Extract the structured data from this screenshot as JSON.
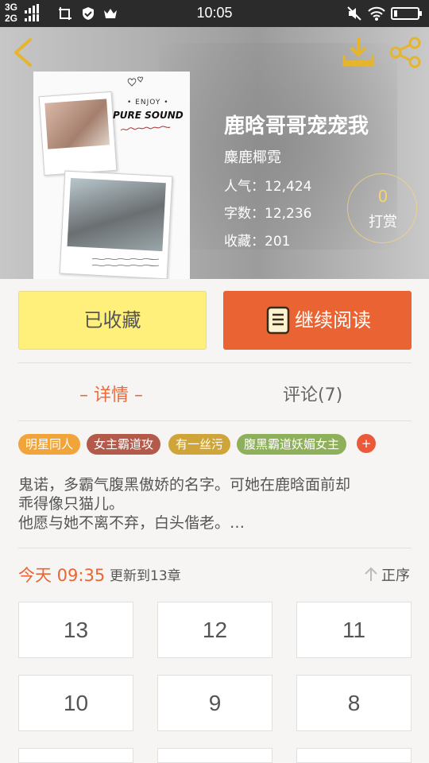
{
  "status_bar": {
    "network": "3G",
    "network2": "2G",
    "time": "10:05"
  },
  "book": {
    "title": "鹿晗哥哥宠宠我",
    "author": "麋鹿椰霓",
    "popularity_label": "人气：",
    "popularity": "12,424",
    "words_label": "字数：",
    "words": "12,236",
    "favorites_label": "收藏：",
    "favorites": "201",
    "tip_count": "0",
    "tip_label": "打赏",
    "cover": {
      "enjoy": "• ENJOY •",
      "pure_sound": "PURE SOUND"
    }
  },
  "actions": {
    "favorited_label": "已收藏",
    "continue_label": "继续阅读"
  },
  "tabs": {
    "detail": "– 详情 –",
    "comments": "评论(7)"
  },
  "tags": [
    {
      "label": "明星同人",
      "color": "#f0a43a"
    },
    {
      "label": "女主霸道攻",
      "color": "#b35a4a"
    },
    {
      "label": "有一丝污",
      "color": "#cfa53a"
    },
    {
      "label": "腹黑霸道妖媚女主",
      "color": "#8fb05a"
    }
  ],
  "tag_more": "+",
  "description": [
    "鬼诺，多霸气腹黑傲娇的名字。可她在鹿晗面前却",
    "乖得像只猫儿。",
    "他愿与她不离不弃，白头偕老。…"
  ],
  "update": {
    "time": "今天 09:35",
    "info": "更新到13章",
    "sort_label": "正序"
  },
  "chapters": [
    "13",
    "12",
    "11",
    "10",
    "9",
    "8"
  ],
  "colors": {
    "accent": "#ea6433",
    "favorite_bg": "#fff07c",
    "tip_ring": "#f7d36a"
  }
}
